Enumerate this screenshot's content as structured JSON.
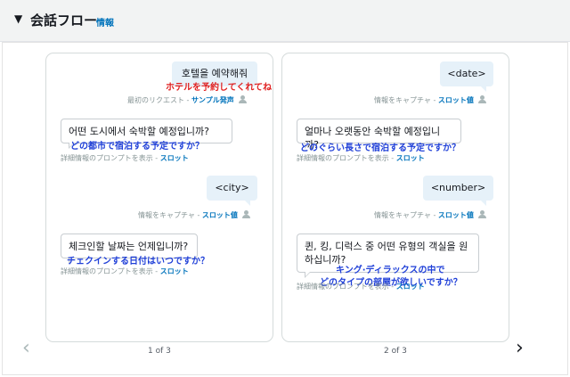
{
  "header": {
    "caret": "▼",
    "title": "会話フロー",
    "info": "情報"
  },
  "nav": {
    "prev": "‹",
    "next": "›"
  },
  "card1": {
    "user1": "호텔을 예약해줘",
    "user1_ann": "ホテルを予約してくれてね",
    "meta1_prefix": "最初のリクエスト - ",
    "meta1_link": "サンプル発声",
    "bot1": "어떤 도시에서 숙박할 예정입니까?",
    "bot1_ann": "どの都市で宿泊する予定ですか？",
    "meta2_prefix": "詳細情報のプロンプトを表示 - ",
    "meta2_link": "スロット",
    "user2": "<city>",
    "meta3_prefix": "情報をキャプチャ - ",
    "meta3_link": "スロット値",
    "bot2": "체크인할 날짜는 언제입니까?",
    "bot2_ann": "チェクインする日付はいつですか？",
    "meta4_prefix": "詳細情報のプロンプトを表示 - ",
    "meta4_link": "スロット",
    "page": "1 of 3"
  },
  "card2": {
    "user1": "<date>",
    "meta1_prefix": "情報をキャプチャ - ",
    "meta1_link": "スロット値",
    "bot1": "얼마나 오랫동안 숙박할 예정입니까?",
    "bot1_ann": "どのぐらい長さで宿泊する予定ですか？",
    "meta2_prefix": "詳細情報のプロンプトを表示 - ",
    "meta2_link": "スロット",
    "user2": "<number>",
    "meta3_prefix": "情報をキャプチャ - ",
    "meta3_link": "スロット値",
    "bot2_line1": "퀸, 킹, 디럭스 중 어떤 유형의 객실을 원",
    "bot2_line2": "하십니까?",
    "bot2_ann1": "キング·ディラックスの中で",
    "bot2_ann2": "どのタイプの部屋が欲しいですか？",
    "meta4_prefix": "詳細情報のプロンプトを表示 - ",
    "meta4_link": "スロット",
    "page": "2 of 3"
  }
}
